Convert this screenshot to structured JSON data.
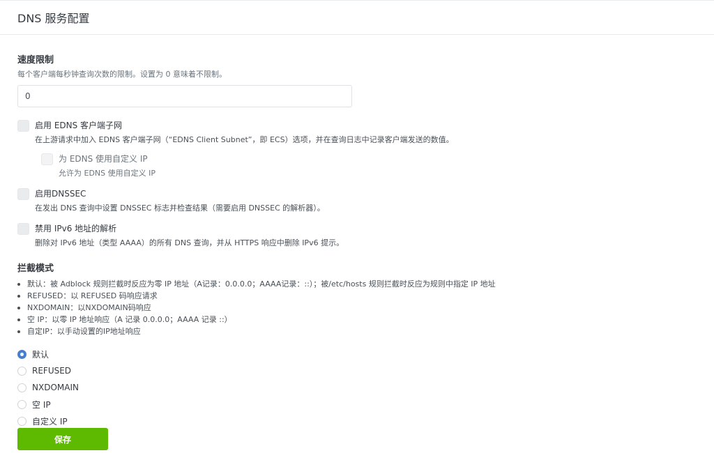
{
  "header": {
    "title": "DNS 服务配置"
  },
  "rate_limit": {
    "label": "速度限制",
    "hint": "每个客户端每秒钟查询次数的限制。设置为 0 意味着不限制。",
    "value": "0"
  },
  "edns": {
    "title": "启用 EDNS 客户端子网",
    "desc": "在上游请求中加入 EDNS 客户端子网（“EDNS Client Subnet”，即 ECS）选项，并在查询日志中记录客户端发送的数值。",
    "custom_ip": {
      "title": "为 EDNS 使用自定义 IP",
      "desc": "允许为 EDNS 使用自定义 IP"
    }
  },
  "dnssec": {
    "title": "启用DNSSEC",
    "desc": "在发出 DNS 查询中设置 DNSSEC 标志并检查结果（需要启用 DNSSEC 的解析器）。"
  },
  "ipv6": {
    "title": "禁用 IPv6 地址的解析",
    "desc": "删除对 IPv6 地址（类型 AAAA）的所有 DNS 查询，并从 HTTPS 响应中删除 IPv6 提示。"
  },
  "blocking_mode": {
    "label": "拦截模式",
    "descriptions": [
      "默认：被 Adblock 规则拦截时反应为零 IP 地址（A记录：0.0.0.0；AAAA记录：::）；被/etc/hosts 规则拦截时反应为规则中指定 IP 地址",
      "REFUSED：以 REFUSED 码响应请求",
      "NXDOMAIN：以NXDOMAIN码响应",
      "空 IP：以零 IP 地址响应（A 记录 0.0.0.0；AAAA 记录 ::）",
      "自定IP：以手动设置的IP地址响应"
    ],
    "options": [
      "默认",
      "REFUSED",
      "NXDOMAIN",
      "空 IP",
      "自定义 IP"
    ],
    "selected": "默认"
  },
  "save_label": "保存",
  "colors": {
    "accent": "#467fcf",
    "save": "#5eba00"
  }
}
